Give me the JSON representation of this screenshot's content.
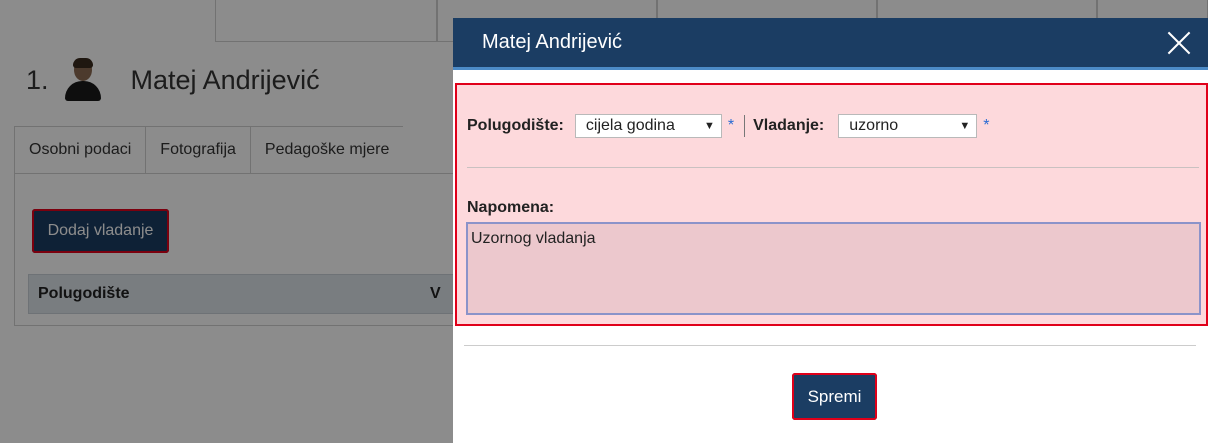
{
  "background": {
    "student_number": "1.",
    "student_name": "Matej Andrijević",
    "tabs": [
      "Osobni podaci",
      "Fotografija",
      "Pedagoške mjere"
    ],
    "add_button_label": "Dodaj vladanje",
    "table_headers": [
      "Polugodište",
      "V"
    ]
  },
  "modal": {
    "title": "Matej Andrijević",
    "polugodiste_label": "Polugodište:",
    "polugodiste_value": "cijela godina",
    "vladanje_label": "Vladanje:",
    "vladanje_value": "uzorno",
    "required_mark": "*",
    "napomena_label": "Napomena:",
    "napomena_value": "Uzornog vladanja",
    "save_label": "Spremi"
  },
  "colors": {
    "header_bg": "#1b3d63",
    "highlight": "#e0001a",
    "form_bg": "#fdd9dc"
  }
}
